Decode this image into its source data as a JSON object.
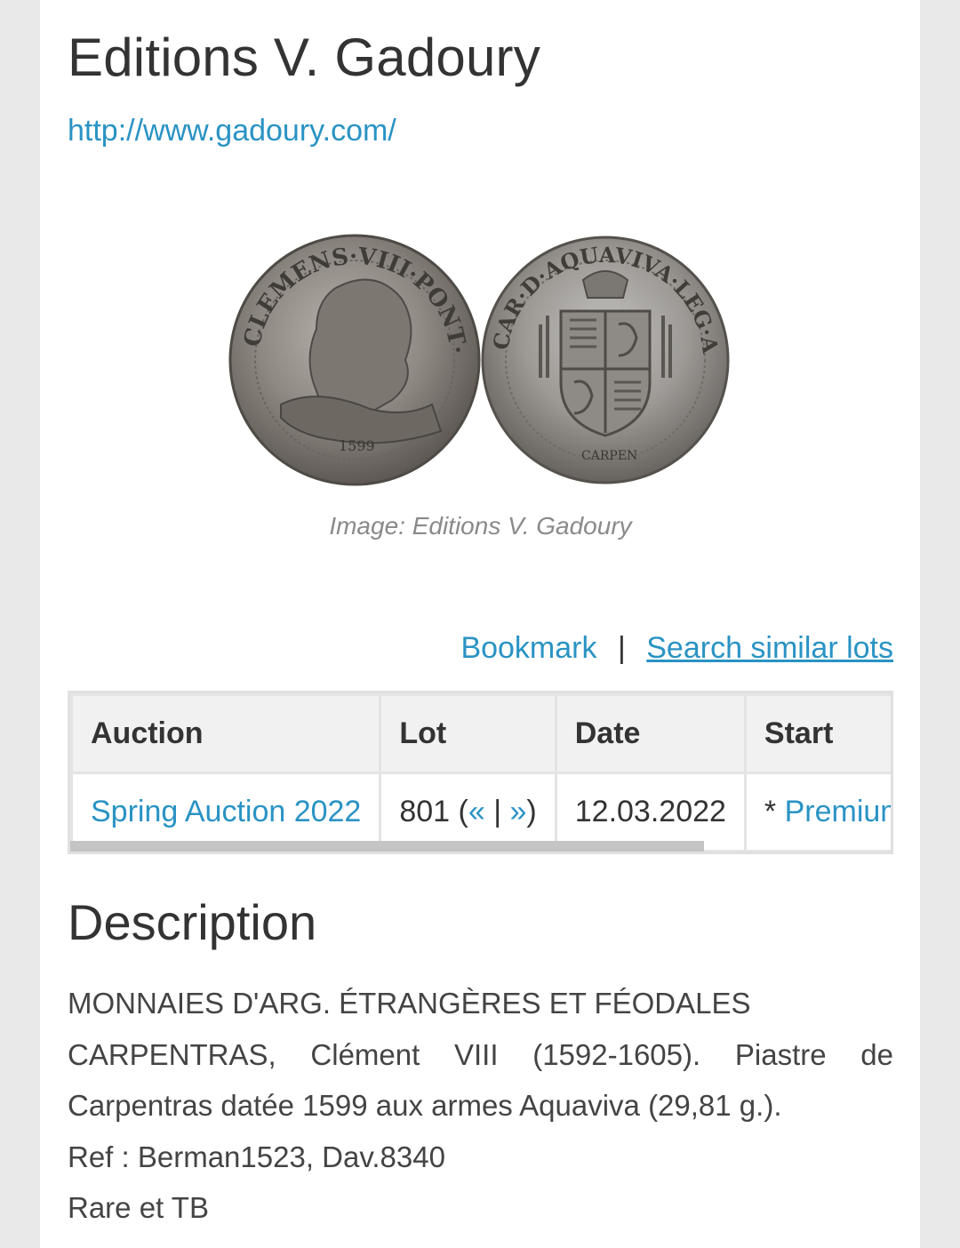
{
  "header": {
    "title": "Editions V. Gadoury",
    "site_url": "http://www.gadoury.com/"
  },
  "image": {
    "caption": "Image: Editions V. Gadoury",
    "obverse_legend": "CLEMENS·VIII·PONT·MAX",
    "obverse_date": "1599",
    "reverse_legend": "CAR·D·AQUAVIVA·LEG·AVE",
    "reverse_mint": "CARPEN"
  },
  "actions": {
    "bookmark": "Bookmark",
    "separator": "|",
    "search_similar": "Search similar lots"
  },
  "table": {
    "headers": {
      "auction": "Auction",
      "lot": "Lot",
      "date": "Date",
      "start": "Start"
    },
    "row": {
      "auction": "Spring Auction 2022",
      "lot_number": "801 (",
      "prev": "«",
      "lot_sep": " | ",
      "next": "»",
      "lot_close": ")",
      "date": "12.03.2022",
      "start_prefix": "* ",
      "start_link": "Premium"
    }
  },
  "description": {
    "title": "Description",
    "line1": "MONNAIES D'ARG. ÉTRANGÈRES ET FÉODALES",
    "line2": "CARPENTRAS, Clément VIII (1592-1605). Piastre de Carpentras datée 1599 aux armes Aquaviva (29,81 g.).",
    "line3": "Ref : Berman1523, Dav.8340",
    "line4": "Rare et TB"
  },
  "colors": {
    "link": "#2a93c4",
    "text": "#333333",
    "caption": "#8a8a8a",
    "header_bg": "#f1f1f1",
    "page_bg": "#e9e9e9"
  }
}
